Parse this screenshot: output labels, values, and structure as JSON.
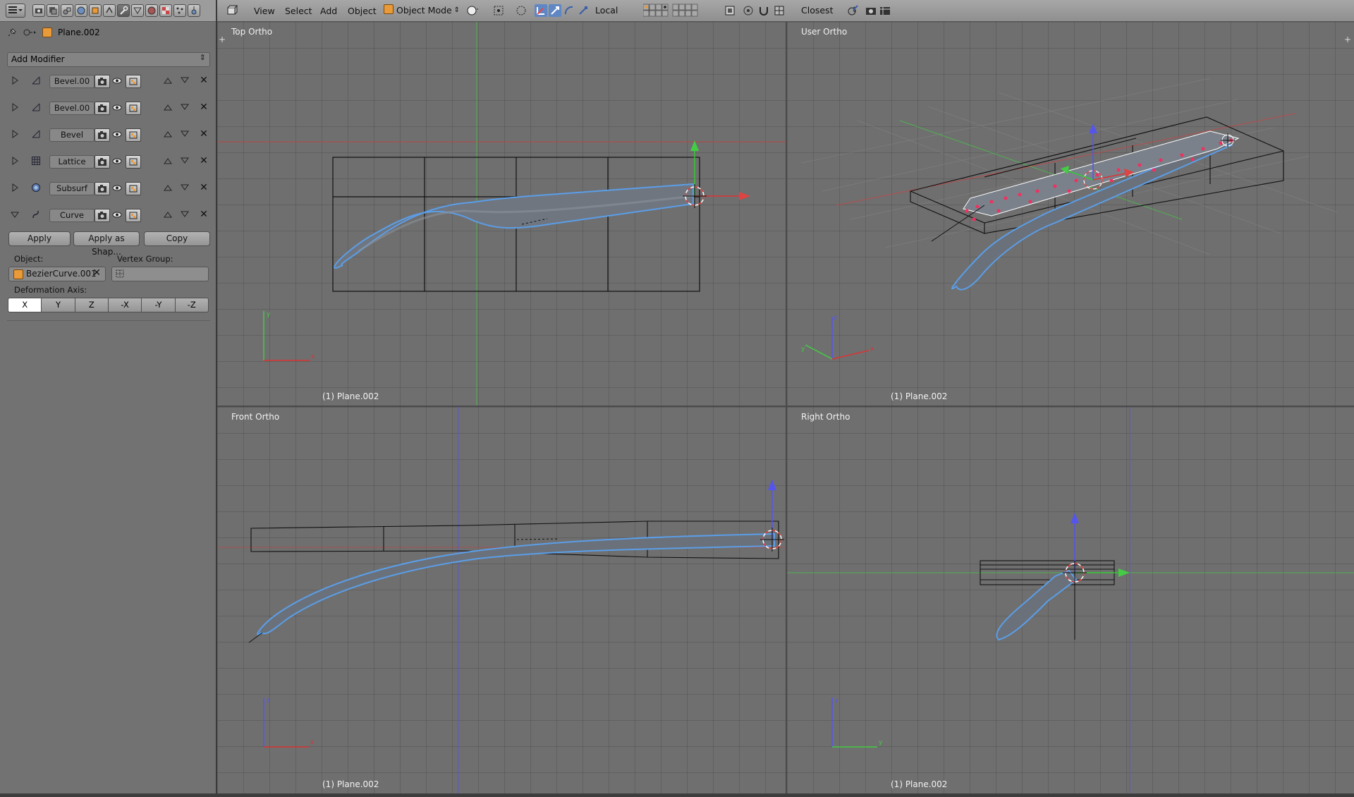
{
  "properties": {
    "object_name": "Plane.002",
    "add_modifier_label": "Add Modifier",
    "modifiers": [
      {
        "name": "Bevel.00",
        "type": "bevel",
        "expanded": false
      },
      {
        "name": "Bevel.00",
        "type": "bevel",
        "expanded": false
      },
      {
        "name": "Bevel",
        "type": "bevel",
        "expanded": false
      },
      {
        "name": "Lattice",
        "type": "lattice",
        "expanded": false
      },
      {
        "name": "Subsurf",
        "type": "subsurf",
        "expanded": false
      },
      {
        "name": "Curve",
        "type": "curve",
        "expanded": true
      }
    ],
    "curve_panel": {
      "apply_label": "Apply",
      "apply_shape_label": "Apply as Shap...",
      "copy_label": "Copy",
      "object_label": "Object:",
      "object_value": "BezierCurve.001",
      "vertex_group_label": "Vertex Group:",
      "deformation_axis_label": "Deformation Axis:",
      "axes": [
        "X",
        "Y",
        "Z",
        "-X",
        "-Y",
        "-Z"
      ],
      "selected_axis": "X"
    }
  },
  "header": {
    "menus": [
      "View",
      "Select",
      "Add",
      "Object"
    ],
    "mode": "Object Mode",
    "pivot": "Local",
    "snap": "Closest"
  },
  "viewports": {
    "top_left": {
      "title": "Top Ortho",
      "footer": "(1) Plane.002"
    },
    "top_right": {
      "title": "User Ortho",
      "footer": "(1) Plane.002"
    },
    "bottom_left": {
      "title": "Front Ortho",
      "footer": "(1) Plane.002"
    },
    "bottom_right": {
      "title": "Right Ortho",
      "footer": "(1) Plane.002"
    }
  },
  "colors": {
    "x_axis": "#d84848",
    "y_axis": "#5cd34a",
    "z_axis": "#5a5ae6",
    "selection_outline": "#5b9ee8",
    "object_icon": "#e99a39"
  }
}
